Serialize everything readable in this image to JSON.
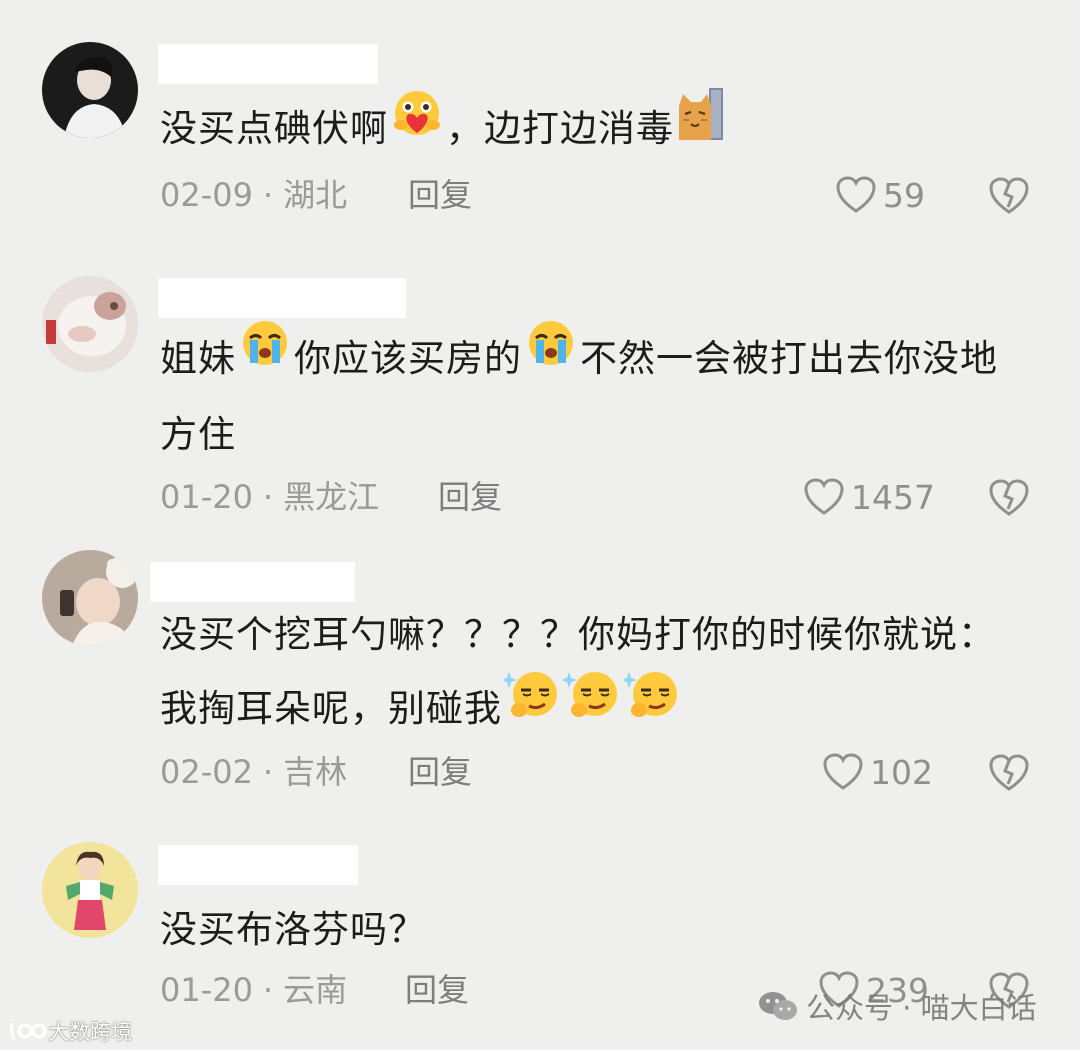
{
  "comments": [
    {
      "avatar": "avatar-young-man",
      "text_parts": [
        "没买点碘伏啊",
        "[emoji:hug-heart]",
        "，边打边消毒",
        "[emoji:peeking-cat]"
      ],
      "date": "02-09",
      "location": "湖北",
      "reply": "回复",
      "likes": "59"
    },
    {
      "avatar": "avatar-cat-photo",
      "text_line1_parts": [
        "姐妹",
        "[emoji:crying]",
        "你应该买房的",
        "[emoji:crying]",
        "不然一会被打出去你没地"
      ],
      "text_line2": "方住",
      "date": "01-20",
      "location": "黑龙江",
      "reply": "回复",
      "likes": "1457"
    },
    {
      "avatar": "avatar-girl-bear-hat",
      "text_line1": "没买个挖耳勺嘛？？？？你妈打你的时候你就说：",
      "text_line2_parts": [
        "我掏耳朵呢，别碰我",
        "[emoji:smirk-sparkle]",
        "[emoji:smirk-sparkle]",
        "[emoji:smirk-sparkle]"
      ],
      "date": "02-02",
      "location": "吉林",
      "reply": "回复",
      "likes": "102"
    },
    {
      "avatar": "avatar-cartoon-girl",
      "text": "没买布洛芬吗？",
      "date": "01-20",
      "location": "云南",
      "reply": "回复",
      "likes": "239"
    }
  ],
  "separator": "·",
  "watermarks": {
    "left": "大数跨境",
    "right": "公众号 · 喵大白话"
  },
  "icons": {
    "like": "heart-outline-icon",
    "dislike": "broken-heart-icon"
  },
  "colors": {
    "background": "#efefed",
    "text": "#1c1c1c",
    "meta": "#9a9a9a"
  }
}
